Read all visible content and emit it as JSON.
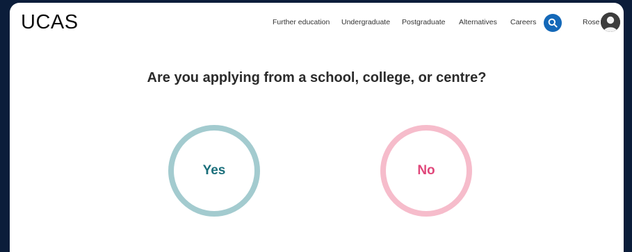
{
  "brand": {
    "logo_text": "UCAS"
  },
  "nav": {
    "items": [
      {
        "label": "Further education"
      },
      {
        "label": "Undergraduate"
      },
      {
        "label": "Postgraduate"
      },
      {
        "label": "Alternatives"
      },
      {
        "label": "Careers"
      }
    ],
    "search_icon": "search-icon",
    "user_name": "Rose",
    "avatar_icon": "user-avatar-icon"
  },
  "main": {
    "question": "Are you applying from a school, college, or centre?",
    "choices": {
      "yes_label": "Yes",
      "no_label": "No"
    }
  },
  "colors": {
    "page_border": "#0b1d3a",
    "search_button": "#1468b8",
    "yes_ring": "#a3cbcf",
    "yes_text": "#1b6f7b",
    "no_ring": "#f6bccb",
    "no_text": "#e0477a"
  }
}
